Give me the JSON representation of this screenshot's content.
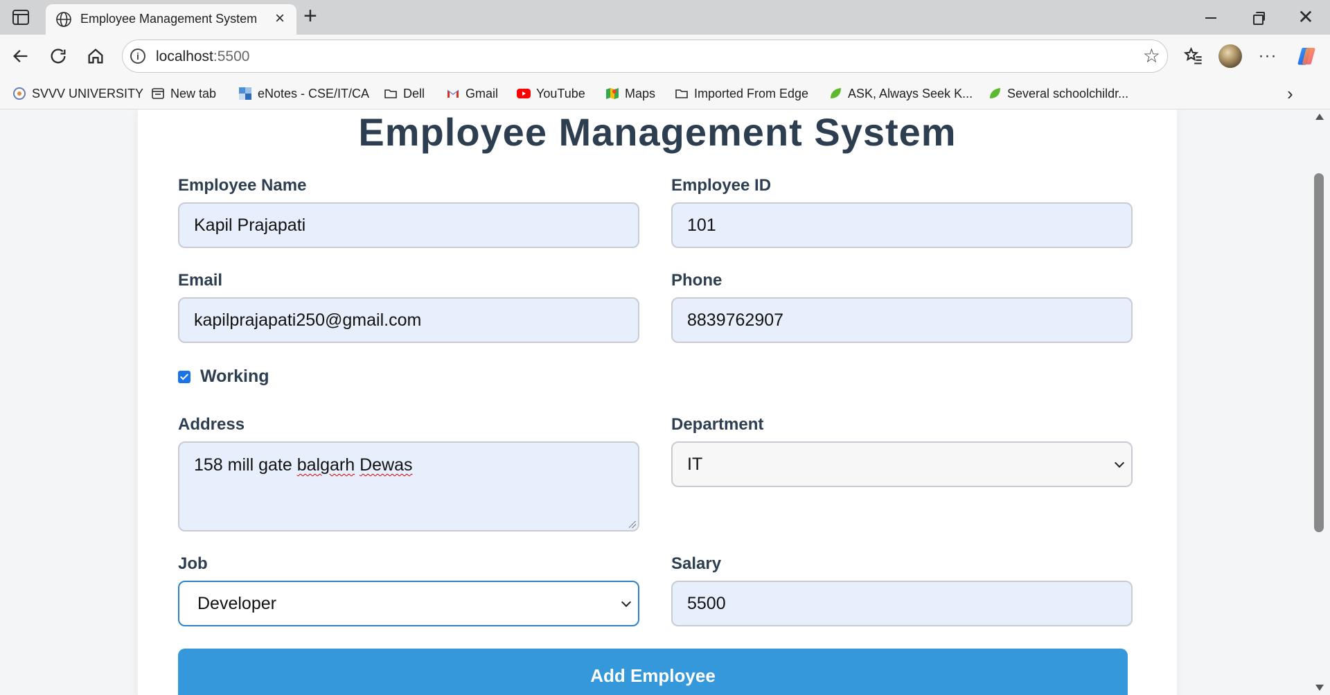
{
  "browser": {
    "tab_title": "Employee Management System",
    "url_host": "localhost",
    "url_port": ":5500",
    "bookmarks": [
      {
        "label": "SVVV UNIVERSITY",
        "icon": "university-icon"
      },
      {
        "label": "New tab",
        "icon": "new-tab-icon"
      },
      {
        "label": "eNotes - CSE/IT/CA",
        "icon": "enotes-icon"
      },
      {
        "label": "Dell",
        "icon": "folder-icon"
      },
      {
        "label": "Gmail",
        "icon": "gmail-icon"
      },
      {
        "label": "YouTube",
        "icon": "youtube-icon"
      },
      {
        "label": "Maps",
        "icon": "maps-icon"
      },
      {
        "label": "Imported From Edge",
        "icon": "folder-icon"
      },
      {
        "label": "ASK, Always Seek K...",
        "icon": "leaf-icon"
      },
      {
        "label": "Several schoolchildr...",
        "icon": "leaf-icon"
      }
    ]
  },
  "page": {
    "title": "Employee Management System"
  },
  "form": {
    "employee_name": {
      "label": "Employee Name",
      "value": "Kapil Prajapati"
    },
    "employee_id": {
      "label": "Employee ID",
      "value": "101"
    },
    "email": {
      "label": "Email",
      "value": "kapilprajapati250@gmail.com"
    },
    "phone": {
      "label": "Phone",
      "value": "8839762907"
    },
    "working": {
      "label": "Working",
      "checked": true
    },
    "address": {
      "label": "Address",
      "value_prefix": "158 mill gate ",
      "value_word1": "balgarh",
      "value_space": " ",
      "value_word2": "Dewas"
    },
    "department": {
      "label": "Department",
      "value": "IT"
    },
    "job": {
      "label": "Job",
      "value": "Developer"
    },
    "salary": {
      "label": "Salary",
      "value": "5500"
    },
    "submit_label": "Add Employee"
  },
  "colors": {
    "heading": "#2c3e50",
    "input_fill": "#e8effc",
    "button": "#3498db",
    "focus_border": "#2c82c9"
  }
}
